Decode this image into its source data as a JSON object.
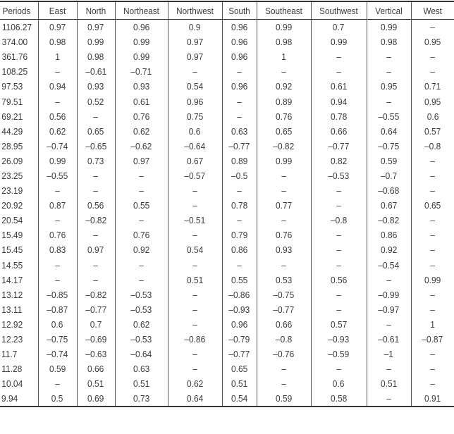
{
  "table": {
    "headers": [
      "Periods",
      "East",
      "North",
      "Northeast",
      "Northwest",
      "South",
      "Southeast",
      "Southwest",
      "Vertical",
      "West"
    ],
    "rows": [
      [
        "1106.27",
        "0.97",
        "0.97",
        "0.96",
        "0.9",
        "0.96",
        "0.99",
        "0.7",
        "0.99",
        "–"
      ],
      [
        "374.00",
        "0.98",
        "0.99",
        "0.99",
        "0.97",
        "0.96",
        "0.98",
        "0.99",
        "0.98",
        "0.95"
      ],
      [
        "361.76",
        "1",
        "0.98",
        "0.99",
        "0.97",
        "0.96",
        "1",
        "–",
        "–",
        "–"
      ],
      [
        "108.25",
        "–",
        "–0.61",
        "–0.71",
        "–",
        "–",
        "–",
        "–",
        "–",
        "–"
      ],
      [
        "97.53",
        "0.94",
        "0.93",
        "0.93",
        "0.54",
        "0.96",
        "0.92",
        "0.61",
        "0.95",
        "0.71"
      ],
      [
        "79.51",
        "–",
        "0.52",
        "0.61",
        "0.96",
        "–",
        "0.89",
        "0.94",
        "–",
        "0.95"
      ],
      [
        "69.21",
        "0.56",
        "–",
        "0.76",
        "0.75",
        "–",
        "0.76",
        "0.78",
        "–0.55",
        "0.6"
      ],
      [
        "44.29",
        "0.62",
        "0.65",
        "0.62",
        "0.6",
        "0.63",
        "0.65",
        "0.66",
        "0.64",
        "0.57"
      ],
      [
        "28.95",
        "–0.74",
        "–0.65",
        "–0.62",
        "–0.64",
        "–0.77",
        "–0.82",
        "–0.77",
        "–0.75",
        "–0.8"
      ],
      [
        "26.09",
        "0.99",
        "0.73",
        "0.97",
        "0.67",
        "0.89",
        "0.99",
        "0.82",
        "0.59",
        "–"
      ],
      [
        "23.25",
        "–0.55",
        "–",
        "–",
        "–0.57",
        "–0.5",
        "–",
        "–0.53",
        "–0.7",
        "–"
      ],
      [
        "23.19",
        "–",
        "–",
        "–",
        "–",
        "–",
        "–",
        "–",
        "–0.68",
        "–"
      ],
      [
        "20.92",
        "0.87",
        "0.56",
        "0.55",
        "–",
        "0.78",
        "0.77",
        "–",
        "0.67",
        "0.65"
      ],
      [
        "20.54",
        "–",
        "–0.82",
        "–",
        "–0.51",
        "–",
        "–",
        "–0.8",
        "–0.82",
        "–"
      ],
      [
        "15.49",
        "0.76",
        "–",
        "0.76",
        "–",
        "0.79",
        "0.76",
        "–",
        "0.86",
        "–"
      ],
      [
        "15.45",
        "0.83",
        "0.97",
        "0.92",
        "0.54",
        "0.86",
        "0.93",
        "–",
        "0.92",
        "–"
      ],
      [
        "14.55",
        "–",
        "–",
        "–",
        "–",
        "–",
        "–",
        "–",
        "–0.54",
        "–"
      ],
      [
        "14.17",
        "–",
        "–",
        "–",
        "0.51",
        "0.55",
        "0.53",
        "0.56",
        "–",
        "0.99"
      ],
      [
        "13.12",
        "–0.85",
        "–0.82",
        "–0.53",
        "–",
        "–0.86",
        "–0.75",
        "–",
        "–0.99",
        "–"
      ],
      [
        "13.11",
        "–0.87",
        "–0.77",
        "–0.53",
        "–",
        "–0.93",
        "–0.77",
        "–",
        "–0.97",
        "–"
      ],
      [
        "12.92",
        "0.6",
        "0.7",
        "0.62",
        "–",
        "0.96",
        "0.66",
        "0.57",
        "–",
        "1"
      ],
      [
        "12.23",
        "–0.75",
        "–0.69",
        "–0.53",
        "–0.86",
        "–0.79",
        "–0.8",
        "–0.93",
        "–0.61",
        "–0.87"
      ],
      [
        "11.7",
        "–0.74",
        "–0.63",
        "–0.64",
        "–",
        "–0.77",
        "–0.76",
        "–0.59",
        "–1",
        "–"
      ],
      [
        "11.28",
        "0.59",
        "0.66",
        "0.63",
        "–",
        "0.65",
        "–",
        "–",
        "–",
        "–"
      ],
      [
        "10.04",
        "–",
        "0.51",
        "0.51",
        "0.62",
        "0.51",
        "–",
        "0.6",
        "0.51",
        "–"
      ],
      [
        "9.94",
        "0.5",
        "0.69",
        "0.73",
        "0.64",
        "0.54",
        "0.59",
        "0.58",
        "–",
        "0.91"
      ]
    ]
  }
}
